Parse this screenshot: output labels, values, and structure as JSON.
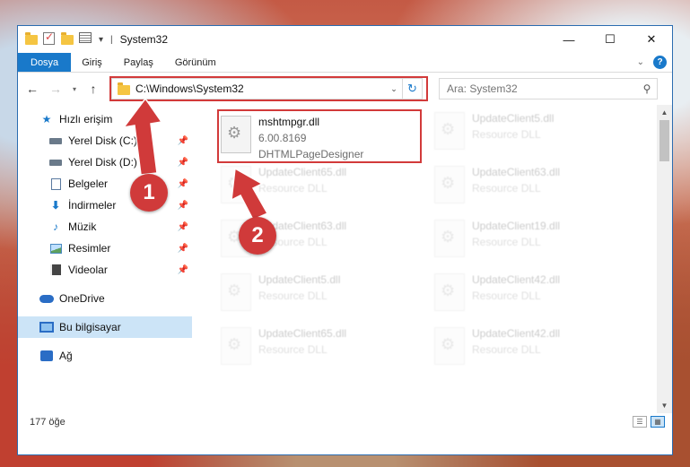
{
  "window": {
    "title": "System32",
    "controls": {
      "minimize": "—",
      "maximize": "☐",
      "close": "✕"
    }
  },
  "ribbon": {
    "tabs": [
      "Dosya",
      "Giriş",
      "Paylaş",
      "Görünüm"
    ],
    "help": "?"
  },
  "address": {
    "path": "C:\\Windows\\System32",
    "search_placeholder": "Ara: System32"
  },
  "nav": {
    "quick_access": "Hızlı erişim",
    "items": [
      {
        "label": "Yerel Disk (C:)",
        "icon": "drive-icon"
      },
      {
        "label": "Yerel Disk (D:)",
        "icon": "drive-icon"
      },
      {
        "label": "Belgeler",
        "icon": "documents-icon"
      },
      {
        "label": "İndirmeler",
        "icon": "downloads-icon"
      },
      {
        "label": "Müzik",
        "icon": "music-icon"
      },
      {
        "label": "Resimler",
        "icon": "pictures-icon"
      },
      {
        "label": "Videolar",
        "icon": "videos-icon"
      }
    ],
    "onedrive": "OneDrive",
    "this_pc": "Bu bilgisayar",
    "network": "Ağ"
  },
  "files": {
    "highlighted": {
      "name": "mshtmpgr.dll",
      "version": "6.00.8169",
      "description": "DHTMLPageDesigner"
    },
    "left_column": [
      {
        "name": "UpdateClient65.dll",
        "desc": "Resource DLL"
      },
      {
        "name": "UpdateClient63.dll",
        "desc": "Resource DLL"
      },
      {
        "name": "UpdateClient5.dll",
        "desc": "Resource DLL"
      },
      {
        "name": "UpdateClient65.dll",
        "desc": "Resource DLL"
      }
    ],
    "right_column": [
      {
        "name": "UpdateClient5.dll",
        "desc": "Resource DLL"
      },
      {
        "name": "UpdateClient63.dll",
        "desc": "Resource DLL"
      },
      {
        "name": "UpdateClient19.dll",
        "desc": "Resource DLL"
      },
      {
        "name": "UpdateClient42.dll",
        "desc": "Resource DLL"
      },
      {
        "name": "UpdateClient42.dll",
        "desc": "Resource DLL"
      }
    ]
  },
  "annotations": {
    "step1": "1",
    "step2": "2",
    "color": "#d23a3a"
  },
  "status": {
    "count": "177 öğe"
  }
}
